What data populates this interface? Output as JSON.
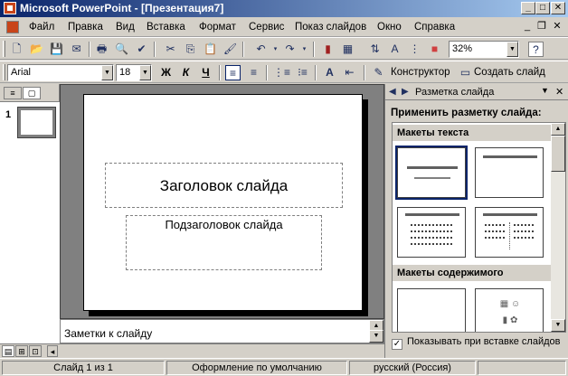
{
  "window": {
    "title": "Microsoft PowerPoint - [Презентация7]"
  },
  "menu": [
    "Файл",
    "Правка",
    "Вид",
    "Вставка",
    "Формат",
    "Сервис",
    "Показ слайдов",
    "Окно",
    "Справка"
  ],
  "toolbar": {
    "zoom": "32%",
    "help": "?"
  },
  "format_toolbar": {
    "font": "Arial",
    "size": "18",
    "bold": "Ж",
    "italic": "К",
    "underline": "Ч",
    "designer": "Конструктор",
    "new_slide": "Создать слайд"
  },
  "left_pane": {
    "slide_number": "1"
  },
  "slide": {
    "title_placeholder": "Заголовок слайда",
    "subtitle_placeholder": "Подзаголовок слайда"
  },
  "notes": {
    "placeholder": "Заметки к слайду"
  },
  "task_pane": {
    "title": "Разметка слайда",
    "apply_label": "Применить разметку слайда:",
    "section_text": "Макеты текста",
    "section_content": "Макеты содержимого",
    "show_on_insert": "Показывать при вставке слайдов",
    "show_on_insert_checked": true
  },
  "status": {
    "slide": "Слайд 1 из 1",
    "design": "Оформление по умолчанию",
    "language": "русский (Россия)"
  }
}
